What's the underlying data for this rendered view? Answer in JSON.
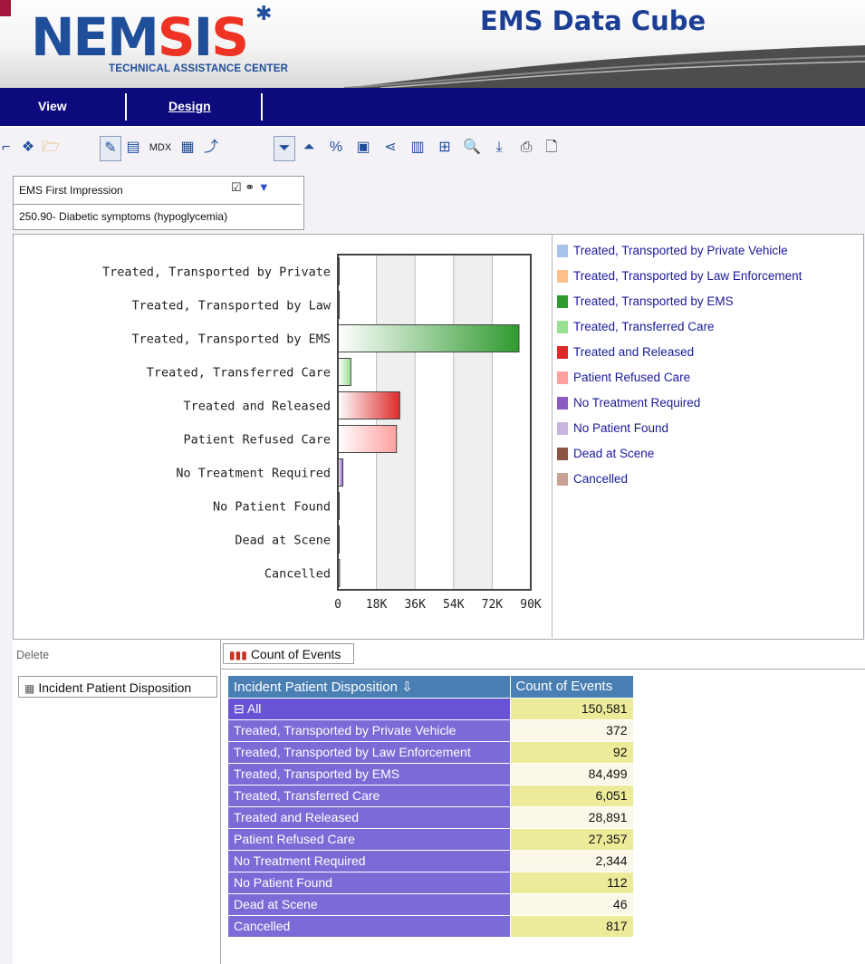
{
  "header": {
    "logo_text": "NEMSIS",
    "logo_subtitle": "TECHNICAL ASSISTANCE CENTER",
    "app_title": "EMS Data Cube"
  },
  "menu": {
    "view_label": "View",
    "design_label": "Design"
  },
  "toolbar": {
    "mdx_label": "MDX",
    "icons": [
      "cube-icon",
      "open-folder-icon",
      "edit-icon",
      "table-icon",
      "mdx-button",
      "chart-icon",
      "drill-icon",
      "filter-icon",
      "top10-icon",
      "percent-icon",
      "calculator-icon",
      "hierarchy-icon",
      "grid-icon",
      "layout-icon",
      "search-icon",
      "export-icon",
      "print-icon",
      "document-icon"
    ]
  },
  "filter": {
    "dimension": "EMS First Impression",
    "value": "250.90- Diabetic symptoms (hypoglycemia)"
  },
  "chart_data": {
    "type": "bar",
    "orientation": "horizontal",
    "categories": [
      "Treated, Transported by Private",
      "Treated, Transported by Law",
      "Treated, Transported by EMS",
      "Treated, Transferred Care",
      "Treated and Released",
      "Patient Refused Care",
      "No Treatment Required",
      "No Patient Found",
      "Dead at Scene",
      "Cancelled"
    ],
    "values": [
      372,
      92,
      84499,
      6051,
      28891,
      27357,
      2344,
      112,
      46,
      817
    ],
    "colors": [
      "#a9c4ea",
      "#ffc08a",
      "#2f9a2f",
      "#98e090",
      "#dd2a2a",
      "#ff9f9f",
      "#8a5bc0",
      "#c8b4de",
      "#8b5542",
      "#c9a094"
    ],
    "xticks": [
      "0",
      "18K",
      "36K",
      "54K",
      "72K",
      "90K"
    ],
    "xlim": [
      0,
      90000
    ],
    "grid": true,
    "legend_position": "right",
    "legend": [
      "Treated, Transported by Private Vehicle",
      "Treated, Transported by Law Enforcement",
      "Treated, Transported by EMS",
      "Treated, Transferred Care",
      "Treated and Released",
      "Patient Refused Care",
      "No Treatment Required",
      "No Patient Found",
      "Dead at Scene",
      "Cancelled"
    ]
  },
  "pivot": {
    "delete_label": "Delete",
    "measure_button": "Count of Events",
    "dimension_button": "Incident Patient Disposition",
    "col_header_dim": "Incident Patient Disposition",
    "col_header_measure": "Count of Events",
    "all_label": "All",
    "all_value": "150,581",
    "rows": [
      {
        "label": "Treated, Transported by Private Vehicle",
        "value": "372"
      },
      {
        "label": "Treated, Transported by Law Enforcement",
        "value": "92"
      },
      {
        "label": "Treated, Transported by EMS",
        "value": "84,499"
      },
      {
        "label": "Treated, Transferred Care",
        "value": "6,051"
      },
      {
        "label": "Treated and Released",
        "value": "28,891"
      },
      {
        "label": "Patient Refused Care",
        "value": "27,357"
      },
      {
        "label": "No Treatment Required",
        "value": "2,344"
      },
      {
        "label": "No Patient Found",
        "value": "112"
      },
      {
        "label": "Dead at Scene",
        "value": "46"
      },
      {
        "label": "Cancelled",
        "value": "817"
      }
    ]
  }
}
